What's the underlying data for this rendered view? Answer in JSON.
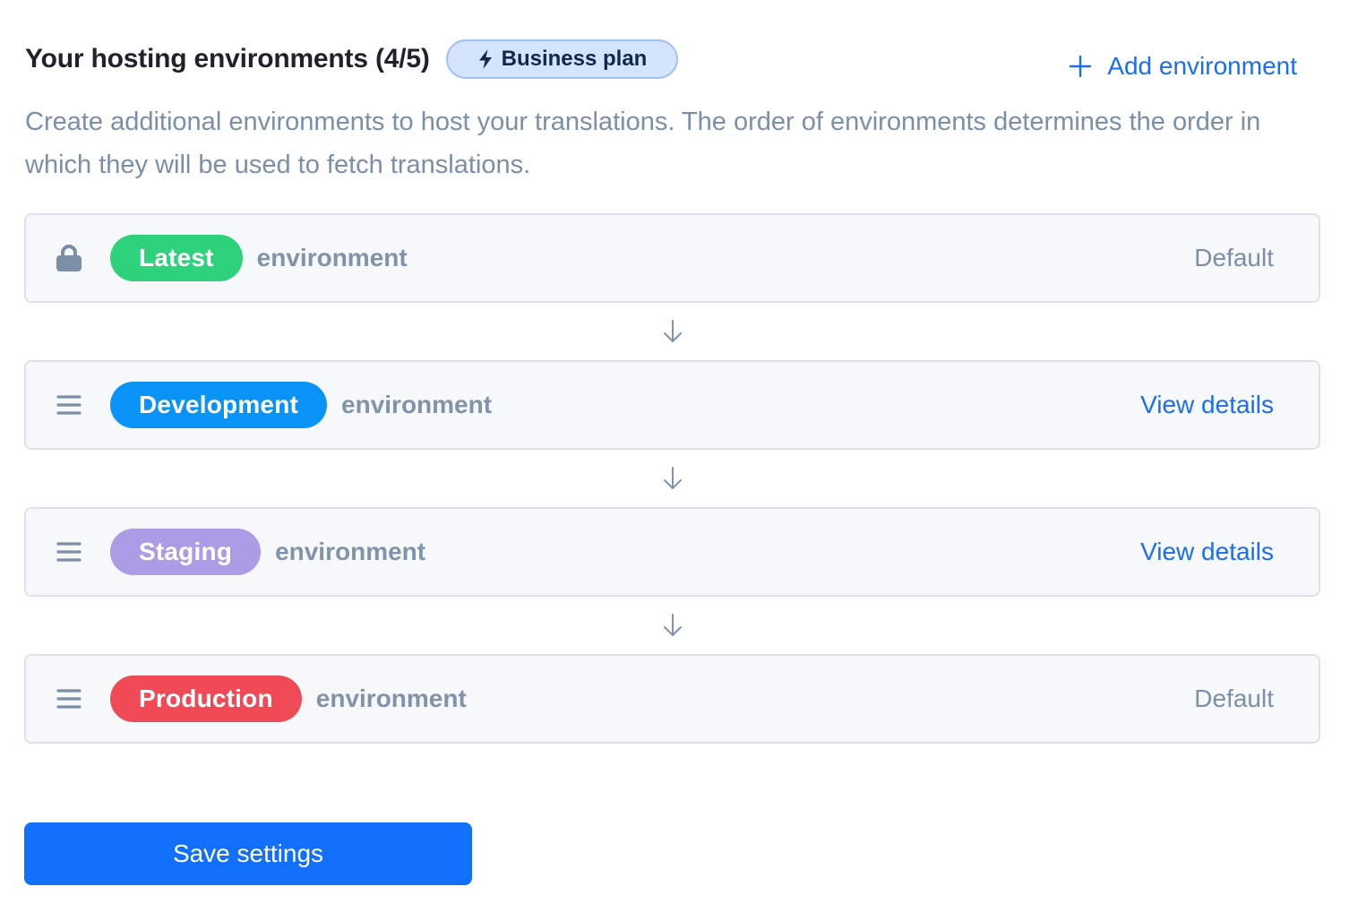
{
  "header": {
    "title": "Your hosting environments (4/5)",
    "plan_badge": {
      "label": "Business plan",
      "icon": "lightning-bolt-icon"
    },
    "add_button": {
      "label": "Add environment",
      "icon": "plus-icon"
    }
  },
  "description": "Create additional environments to host your translations. The order of environments determines the order in which they will be used to fetch translations.",
  "environments": [
    {
      "name": "Latest",
      "suffix": "environment",
      "color": "#2ed27d",
      "left_icon": "lock-icon",
      "right_label": "Default",
      "right_type": "default"
    },
    {
      "name": "Development",
      "suffix": "environment",
      "color": "#0a93f7",
      "left_icon": "drag-handle-icon",
      "right_label": "View details",
      "right_type": "link"
    },
    {
      "name": "Staging",
      "suffix": "environment",
      "color": "#ad9be6",
      "left_icon": "drag-handle-icon",
      "right_label": "View details",
      "right_type": "link"
    },
    {
      "name": "Production",
      "suffix": "environment",
      "color": "#f04a57",
      "left_icon": "drag-handle-icon",
      "right_label": "Default",
      "right_type": "default"
    }
  ],
  "save_button": {
    "label": "Save settings"
  },
  "colors": {
    "accent": "#116ffb",
    "link": "#1a6ef5",
    "muted_text": "#7b8fa8",
    "card_bg": "#f7f8fa",
    "card_border": "#dde2ea"
  }
}
